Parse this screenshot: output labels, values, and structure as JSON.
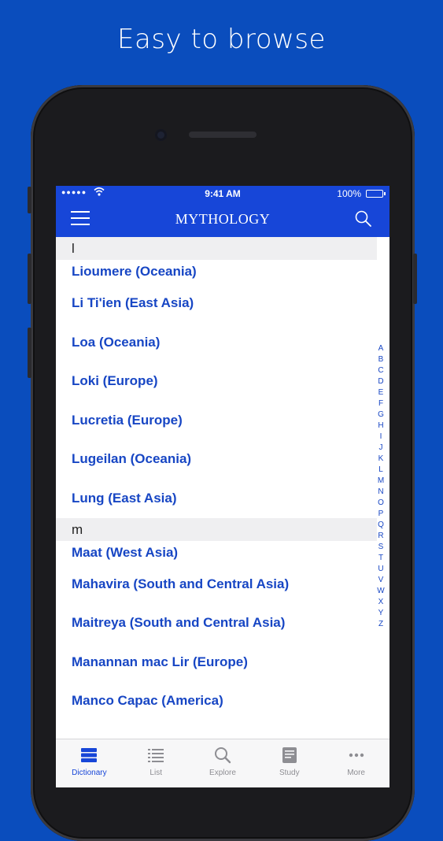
{
  "promo": {
    "headline": "Easy to browse"
  },
  "status_bar": {
    "signal": "●●●●●",
    "time": "9:41 AM",
    "battery": "100%"
  },
  "nav_bar": {
    "title": "MYTHOLOGY"
  },
  "list": {
    "sections": [
      {
        "header": "l",
        "items": [
          "Lioumere (Oceania)",
          "Li Ti'ien (East Asia)",
          "Loa (Oceania)",
          "Loki (Europe)",
          "Lucretia (Europe)",
          "Lugeilan (Oceania)",
          "Lung (East Asia)"
        ]
      },
      {
        "header": "m",
        "items": [
          "Maat (West Asia)",
          "Mahavira (South and Central Asia)",
          "Maitreya (South and Central Asia)",
          "Manannan mac Lir (Europe)",
          "Manco Capac (America)"
        ]
      }
    ]
  },
  "alpha_index": [
    "A",
    "B",
    "C",
    "D",
    "E",
    "F",
    "G",
    "H",
    "I",
    "J",
    "K",
    "L",
    "M",
    "N",
    "O",
    "P",
    "Q",
    "R",
    "S",
    "T",
    "U",
    "V",
    "W",
    "X",
    "Y",
    "Z"
  ],
  "tab_bar": {
    "tabs": [
      {
        "label": "Dictionary",
        "icon": "dictionary-icon",
        "active": true
      },
      {
        "label": "List",
        "icon": "list-icon",
        "active": false
      },
      {
        "label": "Explore",
        "icon": "search-icon",
        "active": false
      },
      {
        "label": "Study",
        "icon": "study-icon",
        "active": false
      },
      {
        "label": "More",
        "icon": "more-icon",
        "active": false
      }
    ]
  },
  "colors": {
    "background": "#0a4dbd",
    "accent": "#1746d8",
    "link": "#1746c4"
  }
}
